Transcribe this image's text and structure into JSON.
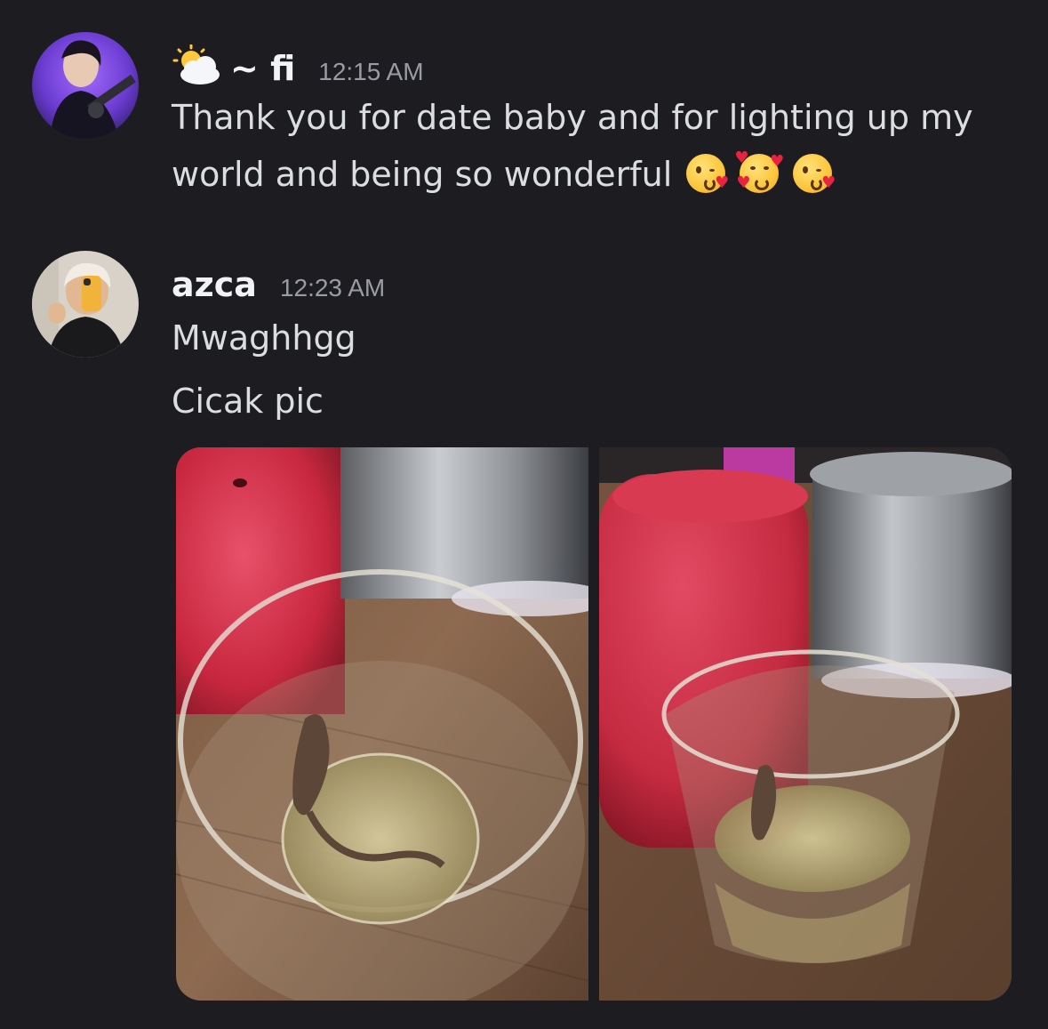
{
  "messages": [
    {
      "username": "~ fi",
      "status_icon": "sun-behind-cloud-icon",
      "timestamp": "12:15 AM",
      "lines": [
        "Thank you for date baby and for lighting up my",
        "world and being so wonderful"
      ],
      "emojis": [
        "face-blowing-kiss-icon",
        "smiling-face-with-hearts-icon",
        "face-blowing-kiss-icon"
      ]
    },
    {
      "username": "azca",
      "timestamp": "12:23 AM",
      "lines": [
        "Mwaghhgg",
        "Cicak pic"
      ],
      "attachments": [
        {
          "icon": "photo-glass-lizard-closeup"
        },
        {
          "icon": "photo-glass-lizard-wide"
        }
      ]
    }
  ],
  "colors": {
    "background": "#1c1c21",
    "username": "#f2f3f5",
    "timestamp": "#9a9ca3",
    "text": "#dbdee1"
  }
}
